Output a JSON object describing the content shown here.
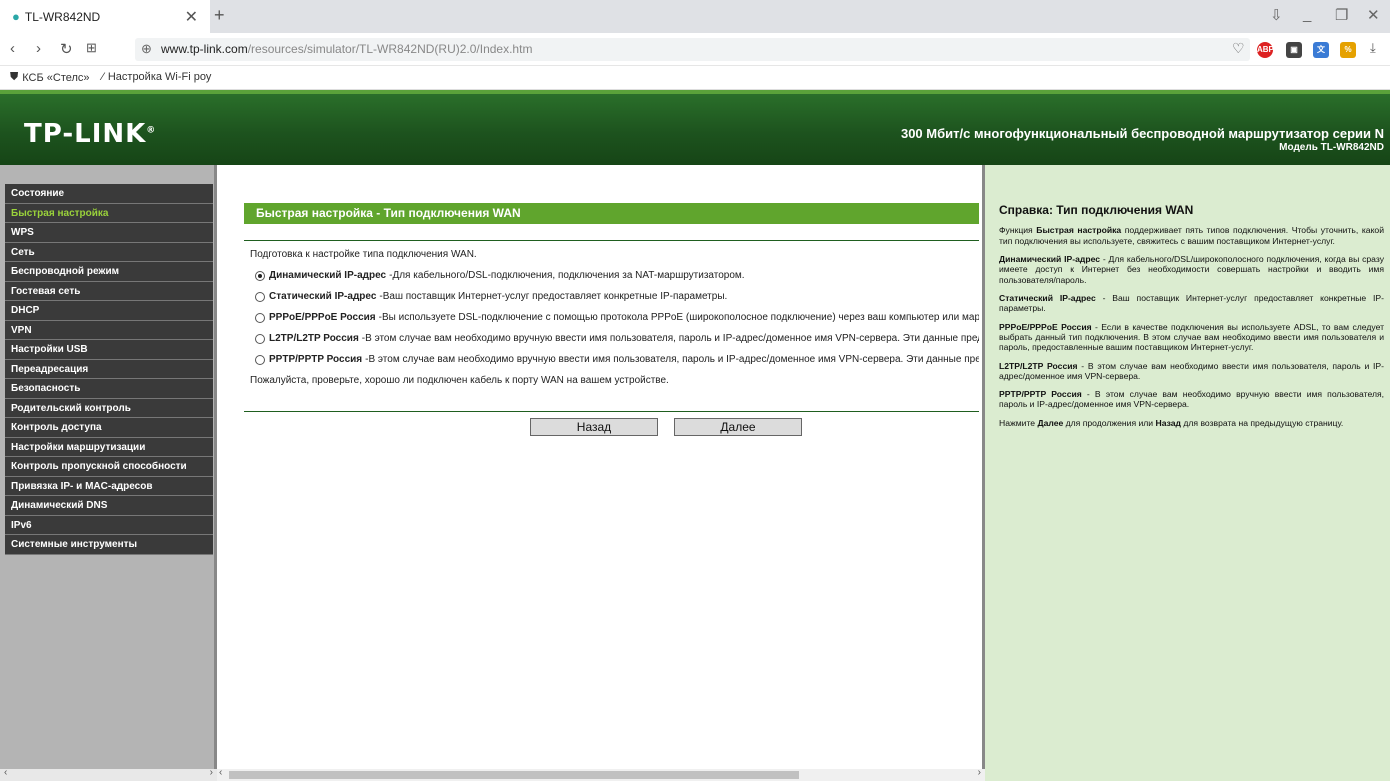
{
  "browser": {
    "tab_title": "TL-WR842ND",
    "url_host": "www.tp-link.com",
    "url_path": "/resources/simulator/TL-WR842ND(RU)2.0/Index.htm",
    "bookmarks": [
      "КСБ «Стелс»",
      "Настройка Wi-Fi роу"
    ]
  },
  "header": {
    "logo": "TP-LINK",
    "title": "300 Мбит/с многофункциональный беспроводной маршрутизатор серии N",
    "model": "Модель TL-WR842ND"
  },
  "sidebar": {
    "items": [
      "Состояние",
      "Быстрая настройка",
      "WPS",
      "Сеть",
      "Беспроводной режим",
      "Гостевая сеть",
      "DHCP",
      "VPN",
      "Настройки USB",
      "Переадресация",
      "Безопасность",
      "Родительский контроль",
      "Контроль доступа",
      "Настройки маршрутизации",
      "Контроль пропускной способности",
      "Привязка IP- и MAC-адресов",
      "Динамический DNS",
      "IPv6",
      "Системные инструменты"
    ],
    "active_index": 1
  },
  "main": {
    "section_title": "Быстрая настройка - Тип подключения WAN",
    "intro": "Подготовка к настройке типа подключения WAN.",
    "options": [
      {
        "label": "Динамический IP-адрес",
        "desc": "Для кабельного/DSL-подключения, подключения за NAT-маршрутизатором.",
        "selected": true
      },
      {
        "label": "Статический IP-адрес",
        "desc": "Ваш поставщик Интернет-услуг предоставляет конкретные IP-параметры.",
        "selected": false
      },
      {
        "label": "PPPoE/PPPoE Россия",
        "desc": "Вы используете DSL-подключение с помощью протокола PPPoE (широкополосное подключение) через ваш компьютер или марш",
        "selected": false
      },
      {
        "label": "L2TP/L2TP Россия",
        "desc": "В этом случае вам необходимо вручную ввести имя пользователя, пароль и IP-адрес/доменное имя VPN-сервера. Эти данные предо",
        "selected": false
      },
      {
        "label": "PPTP/PPTP Россия",
        "desc": "В этом случае вам необходимо вручную ввести имя пользователя, пароль и IP-адрес/доменное имя VPN-сервера. Эти данные предо",
        "selected": false
      }
    ],
    "note": "Пожалуйста, проверьте, хорошо ли подключен кабель к порту WAN на вашем устройстве.",
    "back_label": "Назад",
    "next_label": "Далее"
  },
  "help": {
    "title": "Справка: Тип подключения WAN",
    "p1_a": "Функция ",
    "p1_b": "Быстрая настройка",
    "p1_c": " поддерживает пять типов подключения. Чтобы уточнить, какой тип подключения вы используете, свяжитесь с вашим поставщиком Интернет-услуг.",
    "p2_b": "Динамический IP-адрес",
    "p2_c": " - Для кабельного/DSL/широкополосного подключения, когда вы сразу имеете доступ к Интернет без необходимости совершать настройки и вводить имя пользователя/пароль.",
    "p3_b": "Статический IP-адрес",
    "p3_c": " - Ваш поставщик Интернет-услуг предоставляет конкретные IP-параметры.",
    "p4_b": "PPPoE/PPPoE Россия",
    "p4_c": " - Если в качестве подключения вы используете ADSL, то вам следует выбрать данный тип подключения. В этом случае вам необходимо ввести имя пользователя и пароль, предоставленные вашим поставщиком Интернет-услуг.",
    "p5_b": "L2TP/L2TP Россия",
    "p5_c": " - В этом случае вам необходимо ввести имя пользователя, пароль и IP-адрес/доменное имя VPN-сервера.",
    "p6_b": "PPTP/PPTP Россия",
    "p6_c": " - В этом случае вам необходимо вручную ввести имя пользователя, пароль и IP-адрес/доменное имя VPN-сервера.",
    "p7_a": "Нажмите ",
    "p7_b": "Далее",
    "p7_c": " для продолжения или ",
    "p7_d": "Назад",
    "p7_e": " для возврата на предыдущую страницу."
  },
  "colors": {
    "header_green": "#1d531e",
    "accent_green": "#60a52d",
    "help_bg": "#dbecd0",
    "menu_bg": "#3a3a3a",
    "menu_active": "#9ad23b"
  }
}
